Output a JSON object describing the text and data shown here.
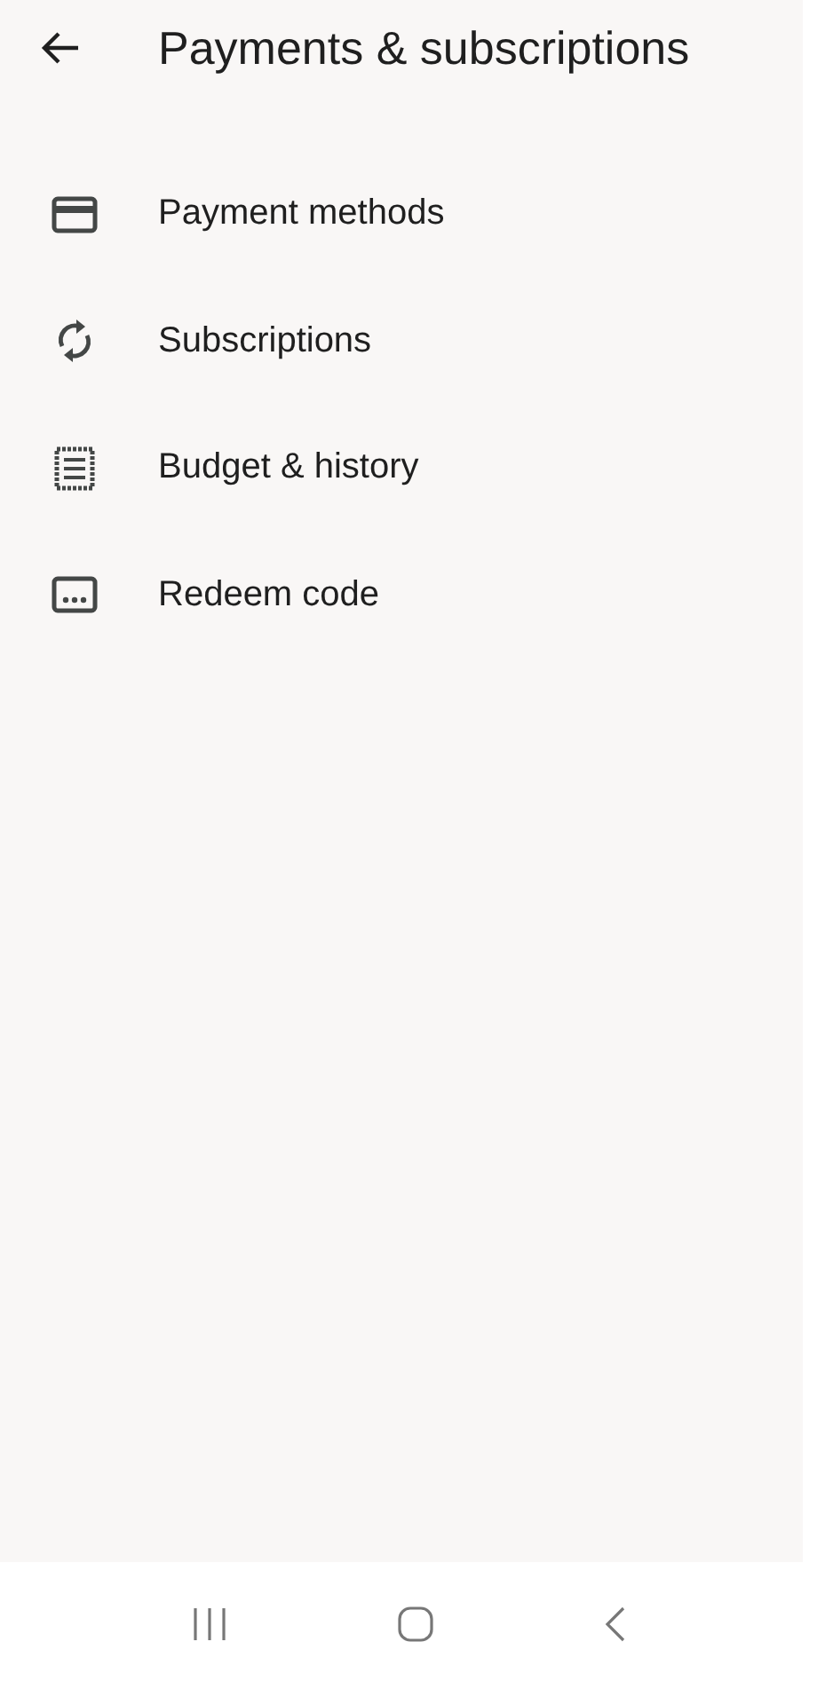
{
  "header": {
    "title": "Payments & subscriptions"
  },
  "items": [
    {
      "label": "Payment methods",
      "kind": "card"
    },
    {
      "label": "Subscriptions",
      "kind": "sync"
    },
    {
      "label": "Budget & history",
      "kind": "receipt"
    },
    {
      "label": "Redeem code",
      "kind": "code"
    }
  ]
}
